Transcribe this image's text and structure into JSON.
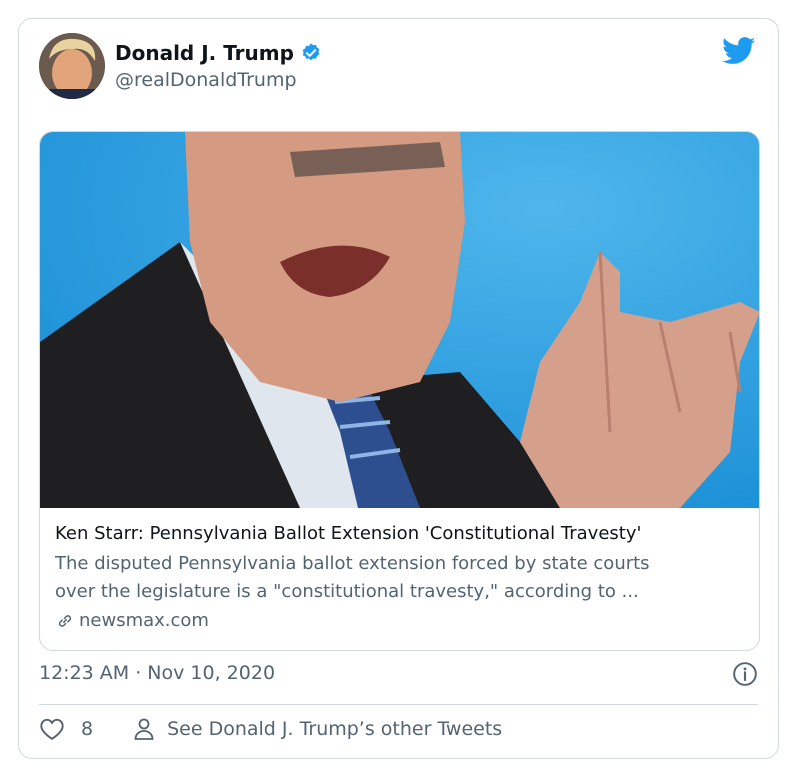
{
  "author": {
    "name": "Donald J. Trump",
    "handle": "@realDonaldTrump",
    "verified": true
  },
  "link_card": {
    "title": "Ken Starr: Pennsylvania Ballot Extension 'Constitutional Travesty'",
    "description_line1": "The disputed Pennsylvania ballot extension forced by state courts",
    "description_line2": "over the legislature is a \"constitutional travesty,\" according to ...",
    "domain": "newsmax.com"
  },
  "timestamp": "12:23 AM · Nov 10, 2020",
  "actions": {
    "like_count": "8",
    "other_tweets_label": "See Donald J. Trump’s other Tweets"
  },
  "colors": {
    "accent": "#1d9bf0",
    "secondary_text": "#536471",
    "border": "#cfd9de"
  },
  "icons": [
    "verified-badge-icon",
    "twitter-bird-icon",
    "link-icon",
    "info-icon",
    "heart-icon",
    "person-icon"
  ]
}
